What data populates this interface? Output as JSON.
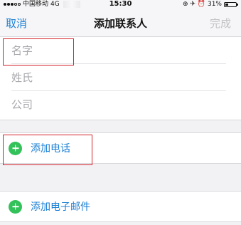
{
  "status_bar": {
    "carrier": "中国移动",
    "network": "4G",
    "time": "15:30",
    "right_icons": "⊕ ✈ ⏰",
    "battery_percent": "31%",
    "battery_level": 0.31
  },
  "nav": {
    "cancel_label": "取消",
    "title": "添加联系人",
    "done_label": "完成",
    "accent_color": "#1a7fd4"
  },
  "form": {
    "fields": [
      {
        "placeholder": "名字"
      },
      {
        "placeholder": "姓氏"
      },
      {
        "placeholder": "公司"
      }
    ]
  },
  "actions": {
    "add_phone_label": "添加电话",
    "add_email_label": "添加电子邮件"
  },
  "annotations": {
    "highlight_color": "#d3232a"
  }
}
